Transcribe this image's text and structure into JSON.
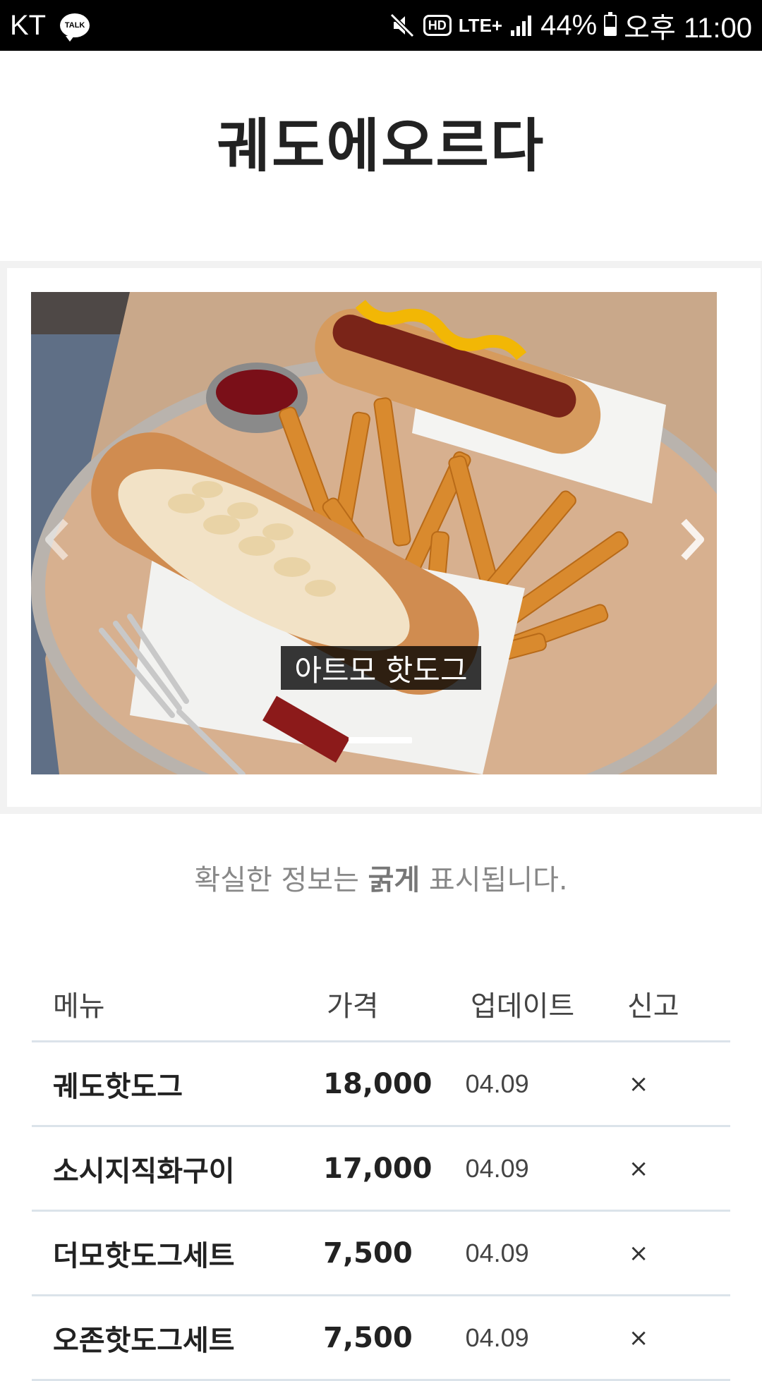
{
  "status_bar": {
    "carrier": "KT",
    "talk_label": "TALK",
    "hd_label": "HD",
    "network": "LTE+",
    "battery": "44%",
    "battery_level": 0.44,
    "time": "오후 11:00",
    "icons": [
      "kakaotalk-icon",
      "mute-icon",
      "hd-voice-icon",
      "lte-icon",
      "signal-icon",
      "battery-icon"
    ]
  },
  "header": {
    "title": "궤도에오르다"
  },
  "carousel": {
    "caption": "아트모 핫도그",
    "prev_icon": "chevron-left-icon",
    "next_icon": "chevron-right-icon",
    "slide_image": "hotdog-and-fries-photo"
  },
  "notice": {
    "prefix": "확실한 정보는 ",
    "bold": "굵게",
    "suffix": " 표시됩니다."
  },
  "table": {
    "headers": {
      "menu": "메뉴",
      "price": "가격",
      "update": "업데이트",
      "report": "신고"
    },
    "rows": [
      {
        "menu": "궤도핫도그",
        "price": "18,000",
        "update": "04.09",
        "report": "×"
      },
      {
        "menu": "소시지직화구이",
        "price": "17,000",
        "update": "04.09",
        "report": "×"
      },
      {
        "menu": "더모핫도그세트",
        "price": "7,500",
        "update": "04.09",
        "report": "×"
      },
      {
        "menu": "오존핫도그세트",
        "price": "7,500",
        "update": "04.09",
        "report": "×"
      }
    ]
  },
  "colors": {
    "status_bar_bg": "#000000",
    "divider": "#dbe3ea",
    "band": "#f2f2f2"
  }
}
